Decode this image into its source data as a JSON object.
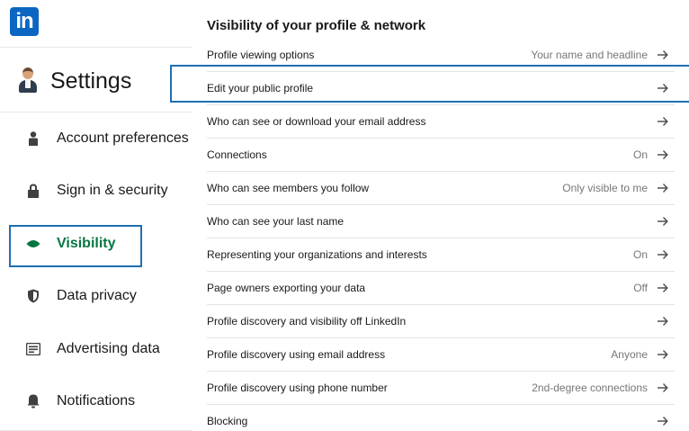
{
  "app": {
    "logo_text": "in"
  },
  "sidebar": {
    "title": "Settings",
    "items": [
      {
        "label": "Account preferences",
        "icon": "person-icon",
        "active": false
      },
      {
        "label": "Sign in & security",
        "icon": "lock-icon",
        "active": false
      },
      {
        "label": "Visibility",
        "icon": "eye-icon",
        "active": true
      },
      {
        "label": "Data privacy",
        "icon": "shield-icon",
        "active": false
      },
      {
        "label": "Advertising data",
        "icon": "newspaper-icon",
        "active": false
      },
      {
        "label": "Notifications",
        "icon": "bell-icon",
        "active": false
      }
    ]
  },
  "main": {
    "section_title": "Visibility of your profile & network",
    "rows": [
      {
        "label": "Profile viewing options",
        "value": "Your name and headline"
      },
      {
        "label": "Edit your public profile",
        "value": ""
      },
      {
        "label": "Who can see or download your email address",
        "value": ""
      },
      {
        "label": "Connections",
        "value": "On"
      },
      {
        "label": "Who can see members you follow",
        "value": "Only visible to me"
      },
      {
        "label": "Who can see your last name",
        "value": ""
      },
      {
        "label": "Representing your organizations and interests",
        "value": "On"
      },
      {
        "label": "Page owners exporting your data",
        "value": "Off"
      },
      {
        "label": "Profile discovery and visibility off LinkedIn",
        "value": ""
      },
      {
        "label": "Profile discovery using email address",
        "value": "Anyone"
      },
      {
        "label": "Profile discovery using phone number",
        "value": "2nd-degree connections"
      },
      {
        "label": "Blocking",
        "value": ""
      }
    ]
  },
  "colors": {
    "brand": "#0a66c2",
    "active": "#057642",
    "highlight_box": "#1f6fb2"
  }
}
